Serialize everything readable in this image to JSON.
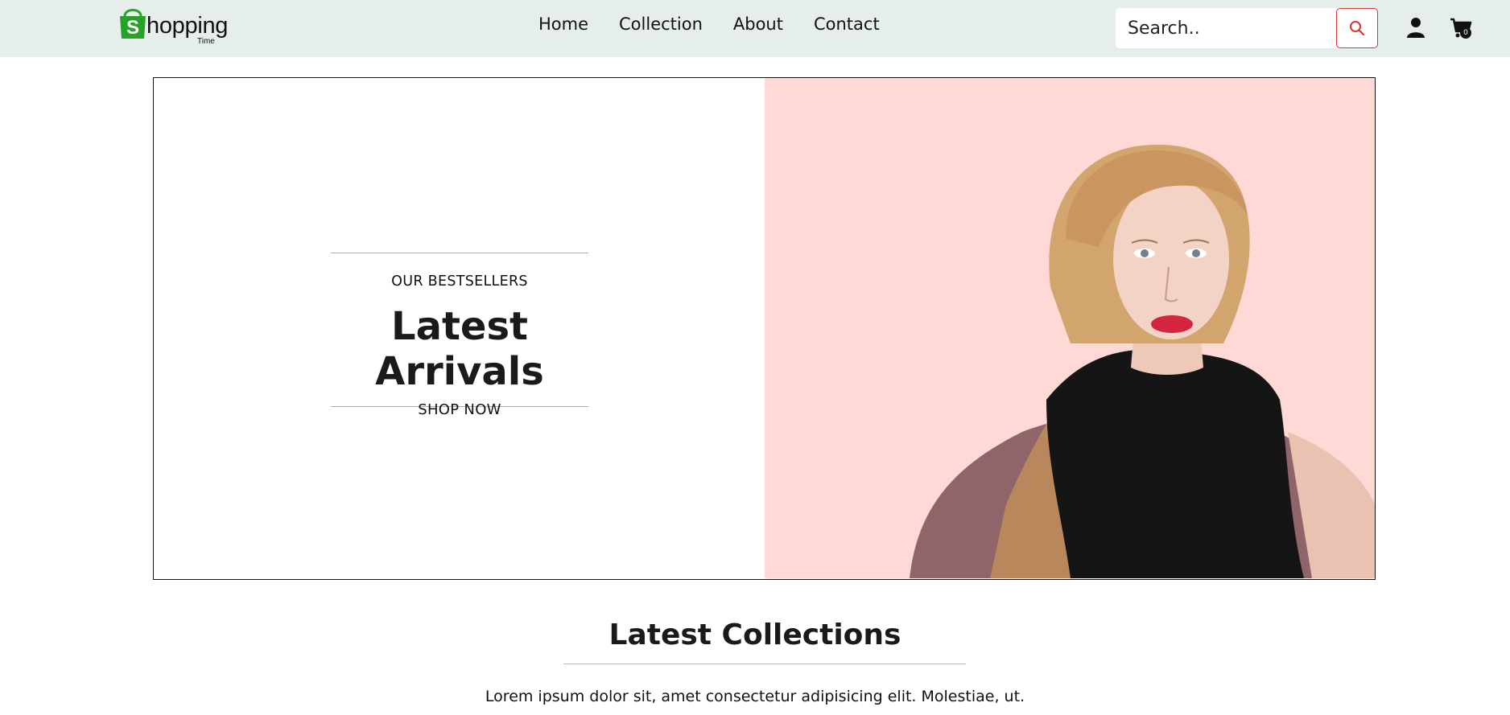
{
  "header": {
    "logo_text": "hopping",
    "logo_sub": "Time",
    "nav": [
      "Home",
      "Collection",
      "About",
      "Contact"
    ],
    "search_placeholder": "Search..",
    "cart_count": "0"
  },
  "hero": {
    "eyebrow": "OUR BESTSELLERS",
    "title": "Latest Arrivals",
    "cta": "SHOP NOW"
  },
  "collections": {
    "title": "Latest Collections",
    "description": "Lorem ipsum dolor sit, amet consectetur adipisicing elit. Molestiae, ut."
  },
  "colors": {
    "header_bg": "#e6eeeb",
    "hero_right_bg": "#ffd9d6",
    "search_accent": "#dd3333",
    "logo_green": "#27a12a"
  }
}
